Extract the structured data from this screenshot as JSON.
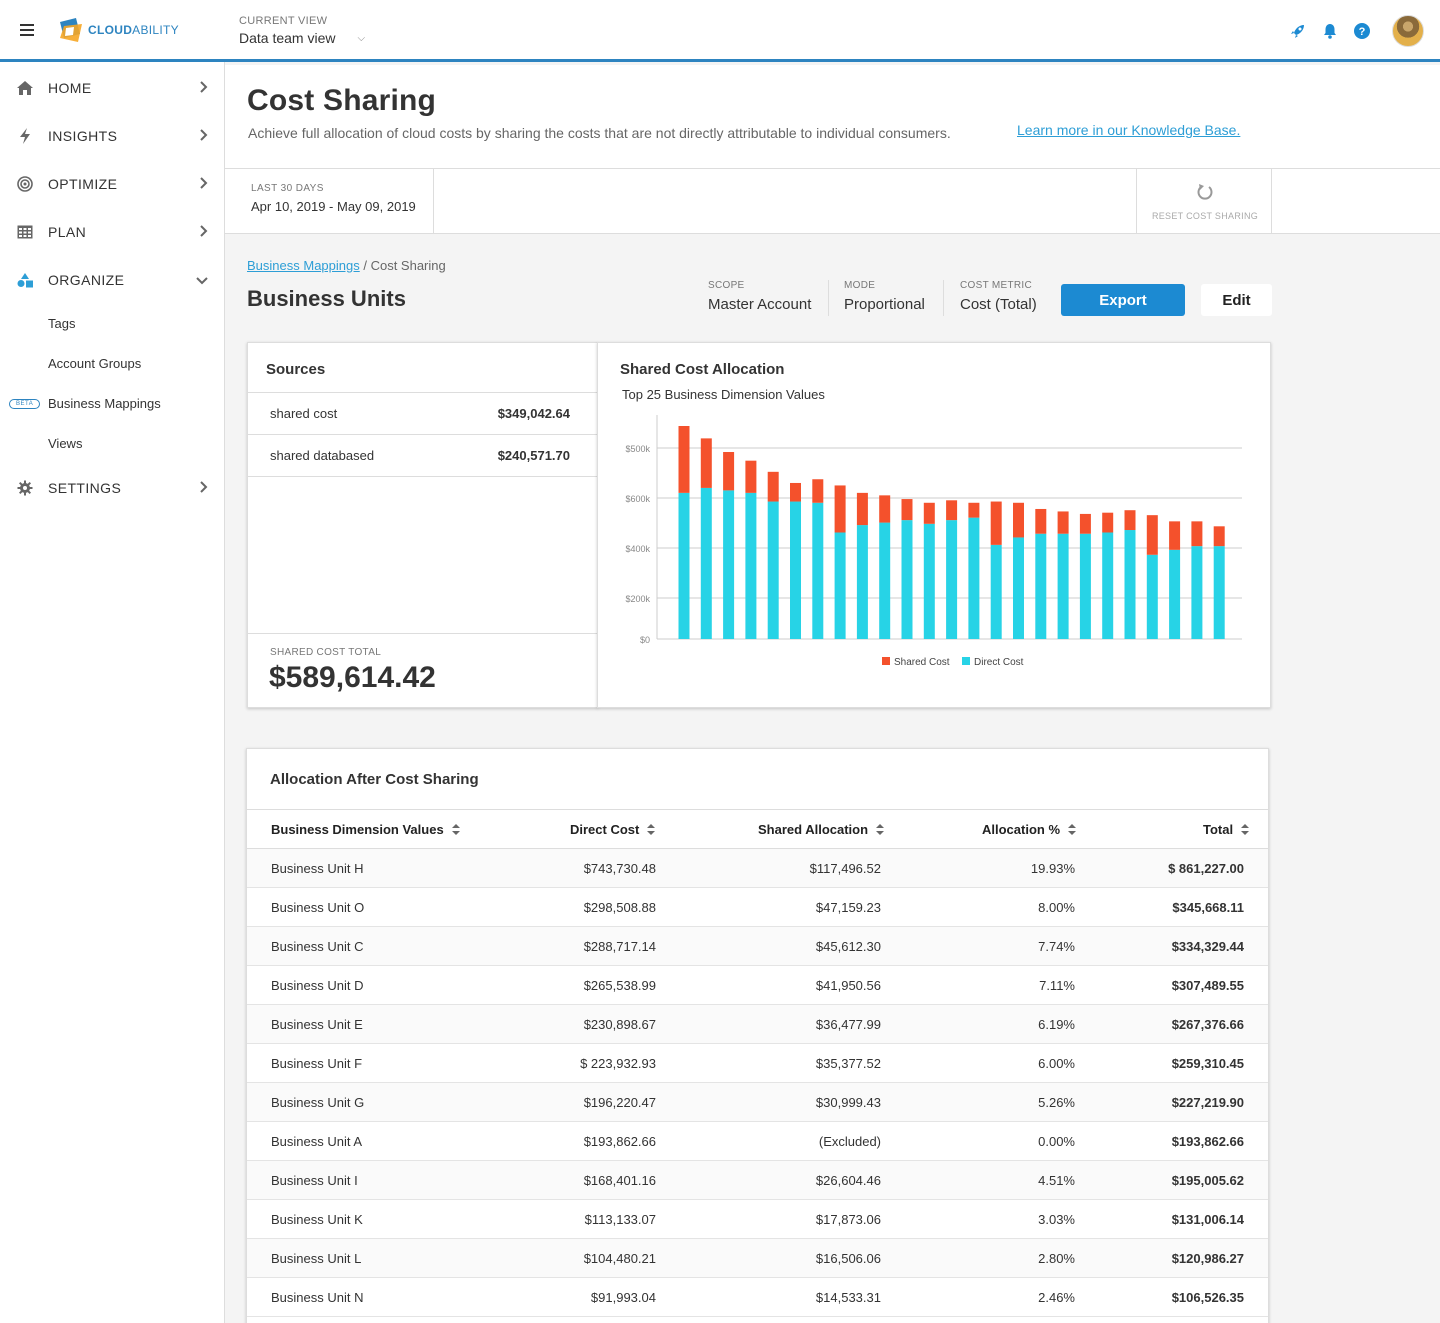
{
  "topbar": {
    "brand_bold": "CLOUD",
    "brand_thin": "ABILITY",
    "current_view_label": "CURRENT VIEW",
    "current_view_value": "Data team view"
  },
  "sidebar": {
    "items": [
      {
        "label": "HOME",
        "icon": "home-icon"
      },
      {
        "label": "INSIGHTS",
        "icon": "lightning-icon"
      },
      {
        "label": "OPTIMIZE",
        "icon": "target-icon"
      },
      {
        "label": "PLAN",
        "icon": "calendar-grid-icon"
      },
      {
        "label": "ORGANIZE",
        "icon": "shapes-icon"
      },
      {
        "label": "SETTINGS",
        "icon": "gear-icon"
      }
    ],
    "sub_items": [
      "Tags",
      "Account Groups",
      "Business Mappings",
      "Views"
    ],
    "beta_label": "BETA"
  },
  "header": {
    "title": "Cost Sharing",
    "subtitle": "Achieve full allocation of cloud costs by sharing the costs that are not directly attributable to individual consumers.",
    "kb_link": "Learn more in our Knowledge Base."
  },
  "date_strip": {
    "label": "LAST 30 DAYS",
    "range": "Apr 10, 2019 - May 09, 2019",
    "reset_label": "RESET COST SHARING"
  },
  "content": {
    "breadcrumb_link": "Business Mappings",
    "breadcrumb_current": "/ Cost Sharing",
    "title": "Business Units",
    "scope_label": "SCOPE",
    "scope_value": "Master Account",
    "mode_label": "MODE",
    "mode_value": "Proportional",
    "metric_label": "COST METRIC",
    "metric_value": "Cost (Total)",
    "export_label": "Export",
    "edit_label": "Edit"
  },
  "sources": {
    "title": "Sources",
    "rows": [
      {
        "name": "shared cost",
        "amount": "$349,042.64"
      },
      {
        "name": "shared databased",
        "amount": "$240,571.70"
      }
    ],
    "total_label": "SHARED COST TOTAL",
    "total_value": "$589,614.42"
  },
  "chart_data": {
    "type": "bar",
    "stacked": true,
    "title": "Shared Cost Allocation",
    "subtitle": "Top 25 Business Dimension Values",
    "y_ticks": [
      "$0",
      "$200k",
      "$400k",
      "$600k",
      "$500k"
    ],
    "legend": [
      "Shared Cost",
      "Direct Cost"
    ],
    "colors": {
      "shared": "#f4512c",
      "direct": "#27d3e6"
    },
    "series": [
      {
        "name": "Direct Cost",
        "values": [
          590,
          610,
          600,
          590,
          555,
          555,
          550,
          430,
          460,
          470,
          480,
          465,
          480,
          490,
          380,
          410,
          425,
          425,
          425,
          430,
          440,
          340,
          360,
          375,
          375
        ]
      },
      {
        "name": "Shared Cost",
        "values": [
          270,
          200,
          155,
          130,
          120,
          75,
          95,
          190,
          130,
          110,
          85,
          85,
          80,
          60,
          175,
          140,
          100,
          90,
          80,
          80,
          80,
          160,
          115,
          100,
          80
        ]
      }
    ],
    "ylim": [
      0,
      860
    ]
  },
  "table": {
    "title": "Allocation After Cost Sharing",
    "columns": [
      "Business Dimension Values",
      "Direct Cost",
      "Shared Allocation",
      "Allocation %",
      "Total"
    ],
    "rows": [
      [
        "Business Unit H",
        "$743,730.48",
        "$117,496.52",
        "19.93%",
        "$ 861,227.00"
      ],
      [
        "Business Unit O",
        "$298,508.88",
        "$47,159.23",
        "8.00%",
        "$345,668.11"
      ],
      [
        "Business Unit C",
        "$288,717.14",
        "$45,612.30",
        "7.74%",
        "$334,329.44"
      ],
      [
        "Business Unit D",
        "$265,538.99",
        "$41,950.56",
        "7.11%",
        "$307,489.55"
      ],
      [
        "Business Unit E",
        "$230,898.67",
        "$36,477.99",
        "6.19%",
        "$267,376.66"
      ],
      [
        "Business Unit F",
        "$ 223,932.93",
        "$35,377.52",
        "6.00%",
        "$259,310.45"
      ],
      [
        "Business Unit G",
        "$196,220.47",
        "$30,999.43",
        "5.26%",
        "$227,219.90"
      ],
      [
        "Business Unit A",
        "$193,862.66",
        "(Excluded)",
        "0.00%",
        "$193,862.66"
      ],
      [
        "Business Unit I",
        "$168,401.16",
        "$26,604.46",
        "4.51%",
        "$195,005.62"
      ],
      [
        "Business Unit K",
        "$113,133.07",
        "$17,873.06",
        "3.03%",
        "$131,006.14"
      ],
      [
        "Business Unit L",
        "$104,480.21",
        "$16,506.06",
        "2.80%",
        "$120,986.27"
      ],
      [
        "Business Unit N",
        "$91,993.04",
        "$14,533.31",
        "2.46%",
        "$106,526.35"
      ]
    ]
  }
}
